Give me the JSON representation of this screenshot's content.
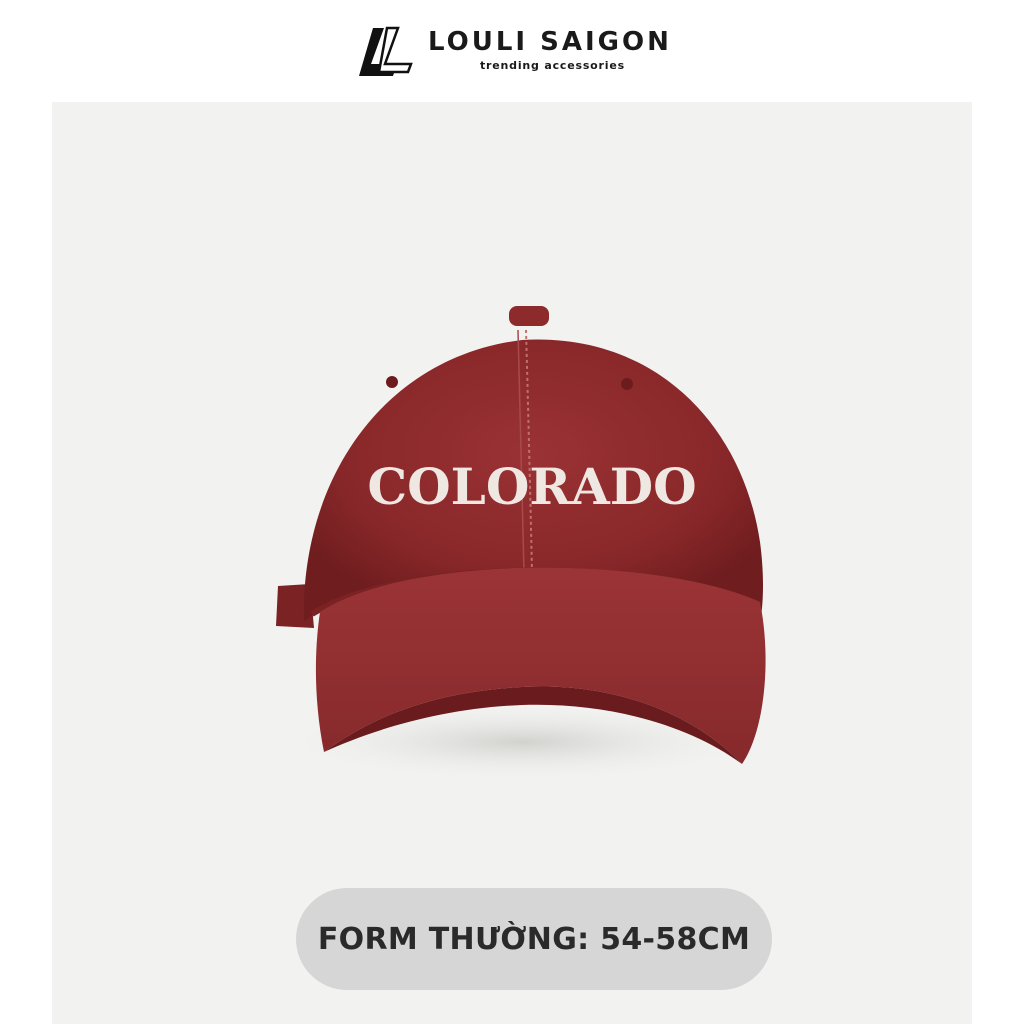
{
  "brand": {
    "name": "LOULI SAIGON",
    "tagline": "trending accessories",
    "logo_icon": "louli-ll-logo-icon"
  },
  "product": {
    "image_icon": "baseball-cap-image",
    "embroidery_text": "COLORADO",
    "cap_color": "#8e2a2c",
    "panel_background": "#f2f2f0"
  },
  "size_badge": {
    "label": "FORM THƯỜNG: 54-58CM",
    "background": "#d6d6d6"
  }
}
